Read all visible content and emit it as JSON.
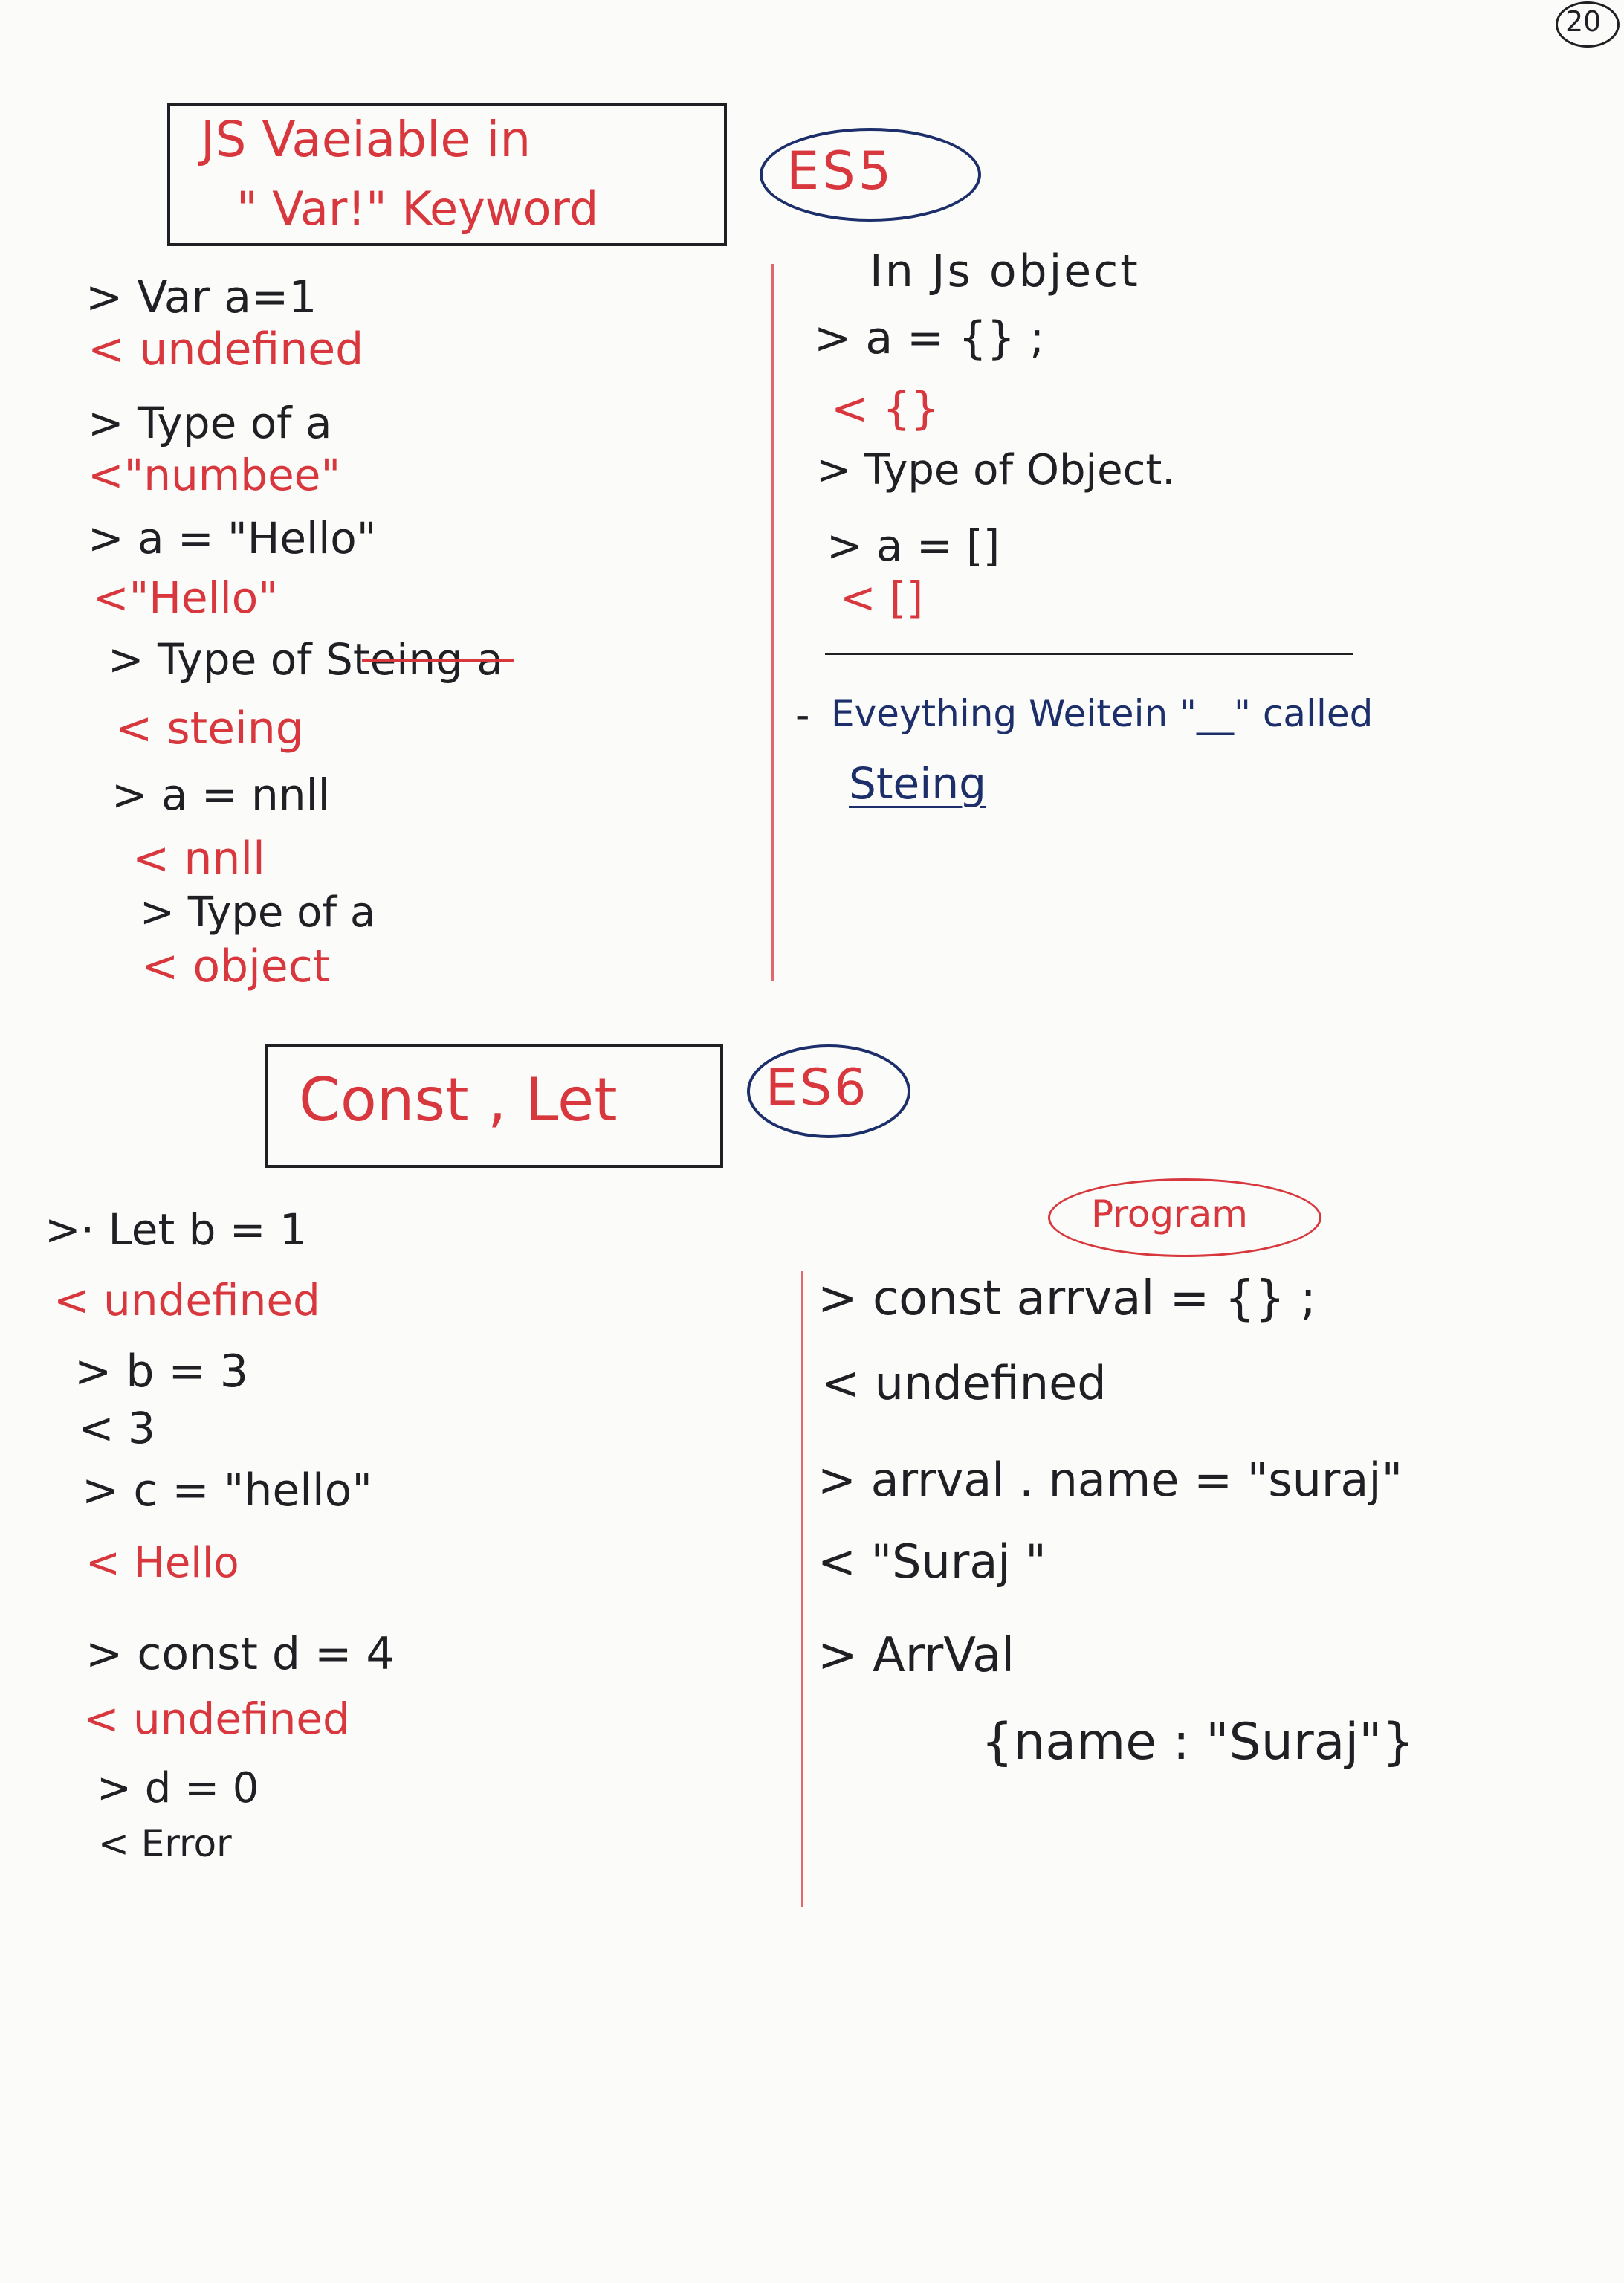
{
  "page_number": "20",
  "colors": {
    "ink": "#1f1f24",
    "red": "#d8383d",
    "navy": "#1d2f6b"
  },
  "section1": {
    "title_line1": "JS Vaeiable in",
    "title_line2": "\" Var!\" Keyword",
    "badge": "ES5",
    "lines": [
      {
        "text": "> Var a=1",
        "color": "ink"
      },
      {
        "text": "< undefined",
        "color": "red"
      },
      {
        "text": "> Type of a",
        "color": "ink"
      },
      {
        "text": "<\"numbee\"",
        "color": "red"
      },
      {
        "text": "> a = \"Hello\"",
        "color": "ink"
      },
      {
        "text": "<\"Hello\"",
        "color": "red"
      },
      {
        "text": "> Type of Steing a",
        "color": "ink"
      },
      {
        "text": "< steing",
        "color": "red"
      },
      {
        "text": "> a = nnll",
        "color": "ink"
      },
      {
        "text": "< nnll",
        "color": "red"
      },
      {
        "text": "> Type of a",
        "color": "ink"
      },
      {
        "text": "< object",
        "color": "red"
      }
    ]
  },
  "objects": {
    "heading": "In Js object",
    "lines": [
      {
        "text": "> a = {} ;",
        "color": "ink"
      },
      {
        "text": "< {}",
        "color": "red"
      },
      {
        "text": "> Type of Object.",
        "color": "ink"
      },
      {
        "text": "> a = []",
        "color": "ink"
      },
      {
        "text": "< []",
        "color": "red"
      }
    ],
    "note_dash": "-",
    "note_text": "Eveything Weitein \"__\" called",
    "note_word": "Steing"
  },
  "section2": {
    "title": "Const , Let",
    "badge": "ES6",
    "lines": [
      {
        "text": ">· Let b = 1",
        "color": "ink"
      },
      {
        "text": "< undefined",
        "color": "red"
      },
      {
        "text": "> b = 3",
        "color": "ink"
      },
      {
        "text": "< 3",
        "color": "ink"
      },
      {
        "text": "> c = \"hello\"",
        "color": "ink"
      },
      {
        "text": "< Hello",
        "color": "red"
      },
      {
        "text": "> const d = 4",
        "color": "ink"
      },
      {
        "text": "< undefined",
        "color": "red"
      },
      {
        "text": "> d = 0",
        "color": "ink"
      },
      {
        "text": "< Error",
        "color": "ink"
      }
    ]
  },
  "program": {
    "badge": "Program",
    "lines": [
      {
        "text": "> const arrval = {} ;",
        "color": "ink"
      },
      {
        "text": "< undefined",
        "color": "ink"
      },
      {
        "text": "> arrval . name = \"suraj\"",
        "color": "ink"
      },
      {
        "text": "< \"Suraj \"",
        "color": "ink"
      },
      {
        "text": "> ArrVal",
        "color": "ink"
      },
      {
        "text": "{name : \"Suraj\"}",
        "color": "ink"
      }
    ]
  }
}
